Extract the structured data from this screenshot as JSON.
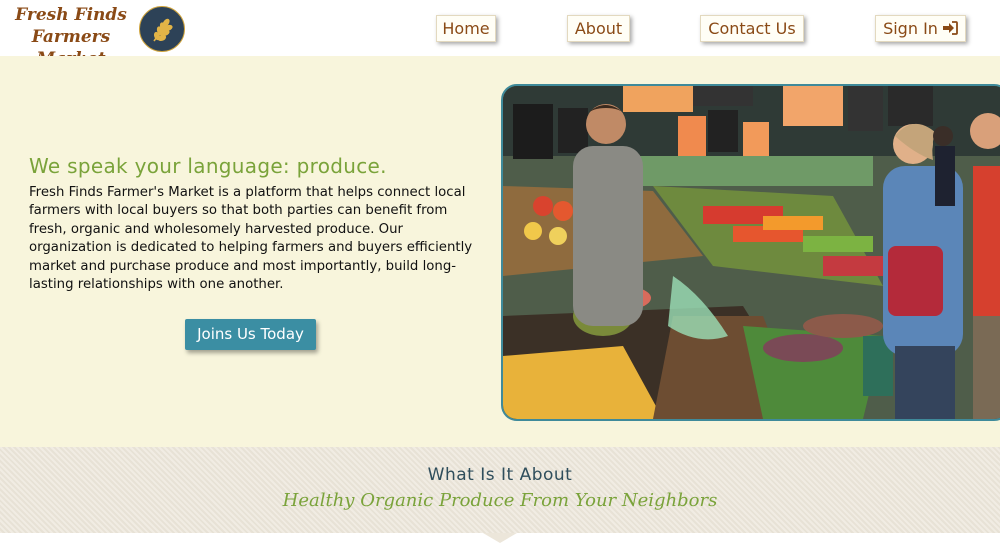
{
  "header": {
    "logo": {
      "line1": "Fresh Finds",
      "line2": "Farmers Market",
      "badge_icon": "wheat-icon"
    },
    "nav": {
      "home": "Home",
      "about": "About",
      "contact": "Contact Us",
      "signin": "Sign In",
      "signin_icon": "sign-in-icon"
    }
  },
  "hero": {
    "heading": "We speak your language: produce.",
    "body": "Fresh Finds Farmer's Market is a platform that helps connect local farmers with local buyers so that both parties can benefit from fresh, organic and wholesomely harvested produce. Our organization is dedicated to helping farmers and buyers efficiently market and purchase produce and most importantly, build long-lasting relationships with one another.",
    "cta": "Joins Us Today"
  },
  "about": {
    "title": "What Is It About",
    "subtitle": "Healthy Organic Produce From Your Neighbors"
  },
  "colors": {
    "brand_brown": "#8a4a16",
    "accent_green": "#7aa33a",
    "button_teal": "#3b8ea3",
    "hero_bg": "#f8f5dc",
    "badge_navy": "#2d4257"
  }
}
